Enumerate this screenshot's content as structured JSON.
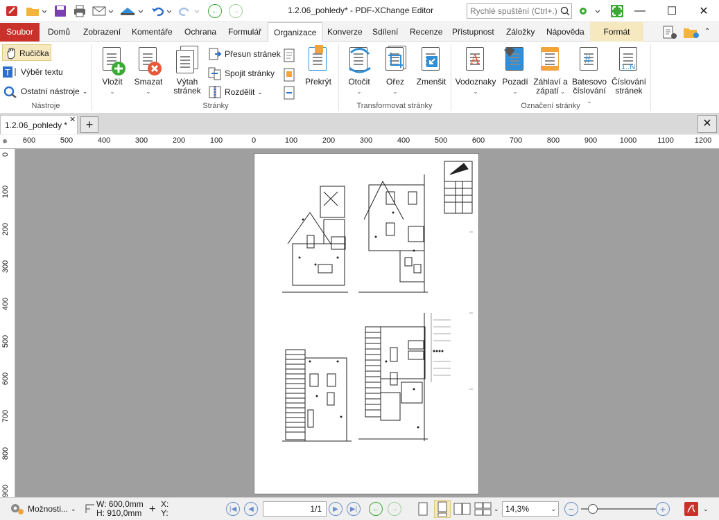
{
  "window": {
    "title": "1.2.06_pohledy* - PDF-XChange Editor",
    "quick_launch_placeholder": "Rychlé spuštění (Ctrl+.)"
  },
  "menu": {
    "items": [
      "Soubor",
      "Domů",
      "Zobrazení",
      "Komentáře",
      "Ochrana",
      "Formulář",
      "Organizace",
      "Konverze",
      "Sdílení",
      "Recenze",
      "Přístupnost",
      "Záložky",
      "Nápověda",
      "Formát"
    ],
    "active": "Organizace"
  },
  "ribbon": {
    "tools": {
      "hand": "Ručička",
      "select_text": "Výběr textu",
      "other_tools": "Ostatní nástroje",
      "group": "Nástroje"
    },
    "pages": {
      "insert": "Vložit",
      "delete": "Smazat",
      "extract_l1": "Výtah",
      "extract_l2": "stránek",
      "move": "Přesun stránek",
      "merge": "Spojit stránky",
      "split": "Rozdělit",
      "overlay": "Překrýt",
      "group": "Stránky"
    },
    "transform": {
      "rotate": "Otočit",
      "crop": "Ořez",
      "shrink": "Zmenšit",
      "group": "Transformovat stránky"
    },
    "marks": {
      "watermarks": "Vodoznaky",
      "backgrounds": "Pozadí",
      "headers_l1": "Záhlaví a",
      "headers_l2": "zápatí",
      "bates_l1": "Batesovo",
      "bates_l2": "číslování",
      "numbering_l1": "Číslování",
      "numbering_l2": "stránek",
      "group": "Označení stránky"
    }
  },
  "document": {
    "tab_label": "1.2.06_pohledy *"
  },
  "ruler": {
    "h_ticks": [
      "600",
      "500",
      "400",
      "300",
      "200",
      "100",
      "0",
      "100",
      "200",
      "300",
      "400",
      "500",
      "600",
      "700",
      "800",
      "900",
      "1000",
      "1100",
      "1200"
    ],
    "v_ticks": [
      "0",
      "100",
      "200",
      "300",
      "400",
      "500",
      "600",
      "700",
      "800",
      "900"
    ]
  },
  "status": {
    "options": "Možnosti...",
    "width": "W: 600,0mm",
    "height": "H: 910,0mm",
    "x": "X:",
    "y": "Y:",
    "page": "1/1",
    "zoom": "14,3%"
  },
  "colors": {
    "accent": "#c8322b",
    "ribbon_active": "#ffffff",
    "format_tab": "#f6e9bf",
    "canvas": "#9f9f9f",
    "icon_blue": "#2f8fd8",
    "icon_orange": "#f2a33a",
    "icon_green": "#3aaa35"
  }
}
